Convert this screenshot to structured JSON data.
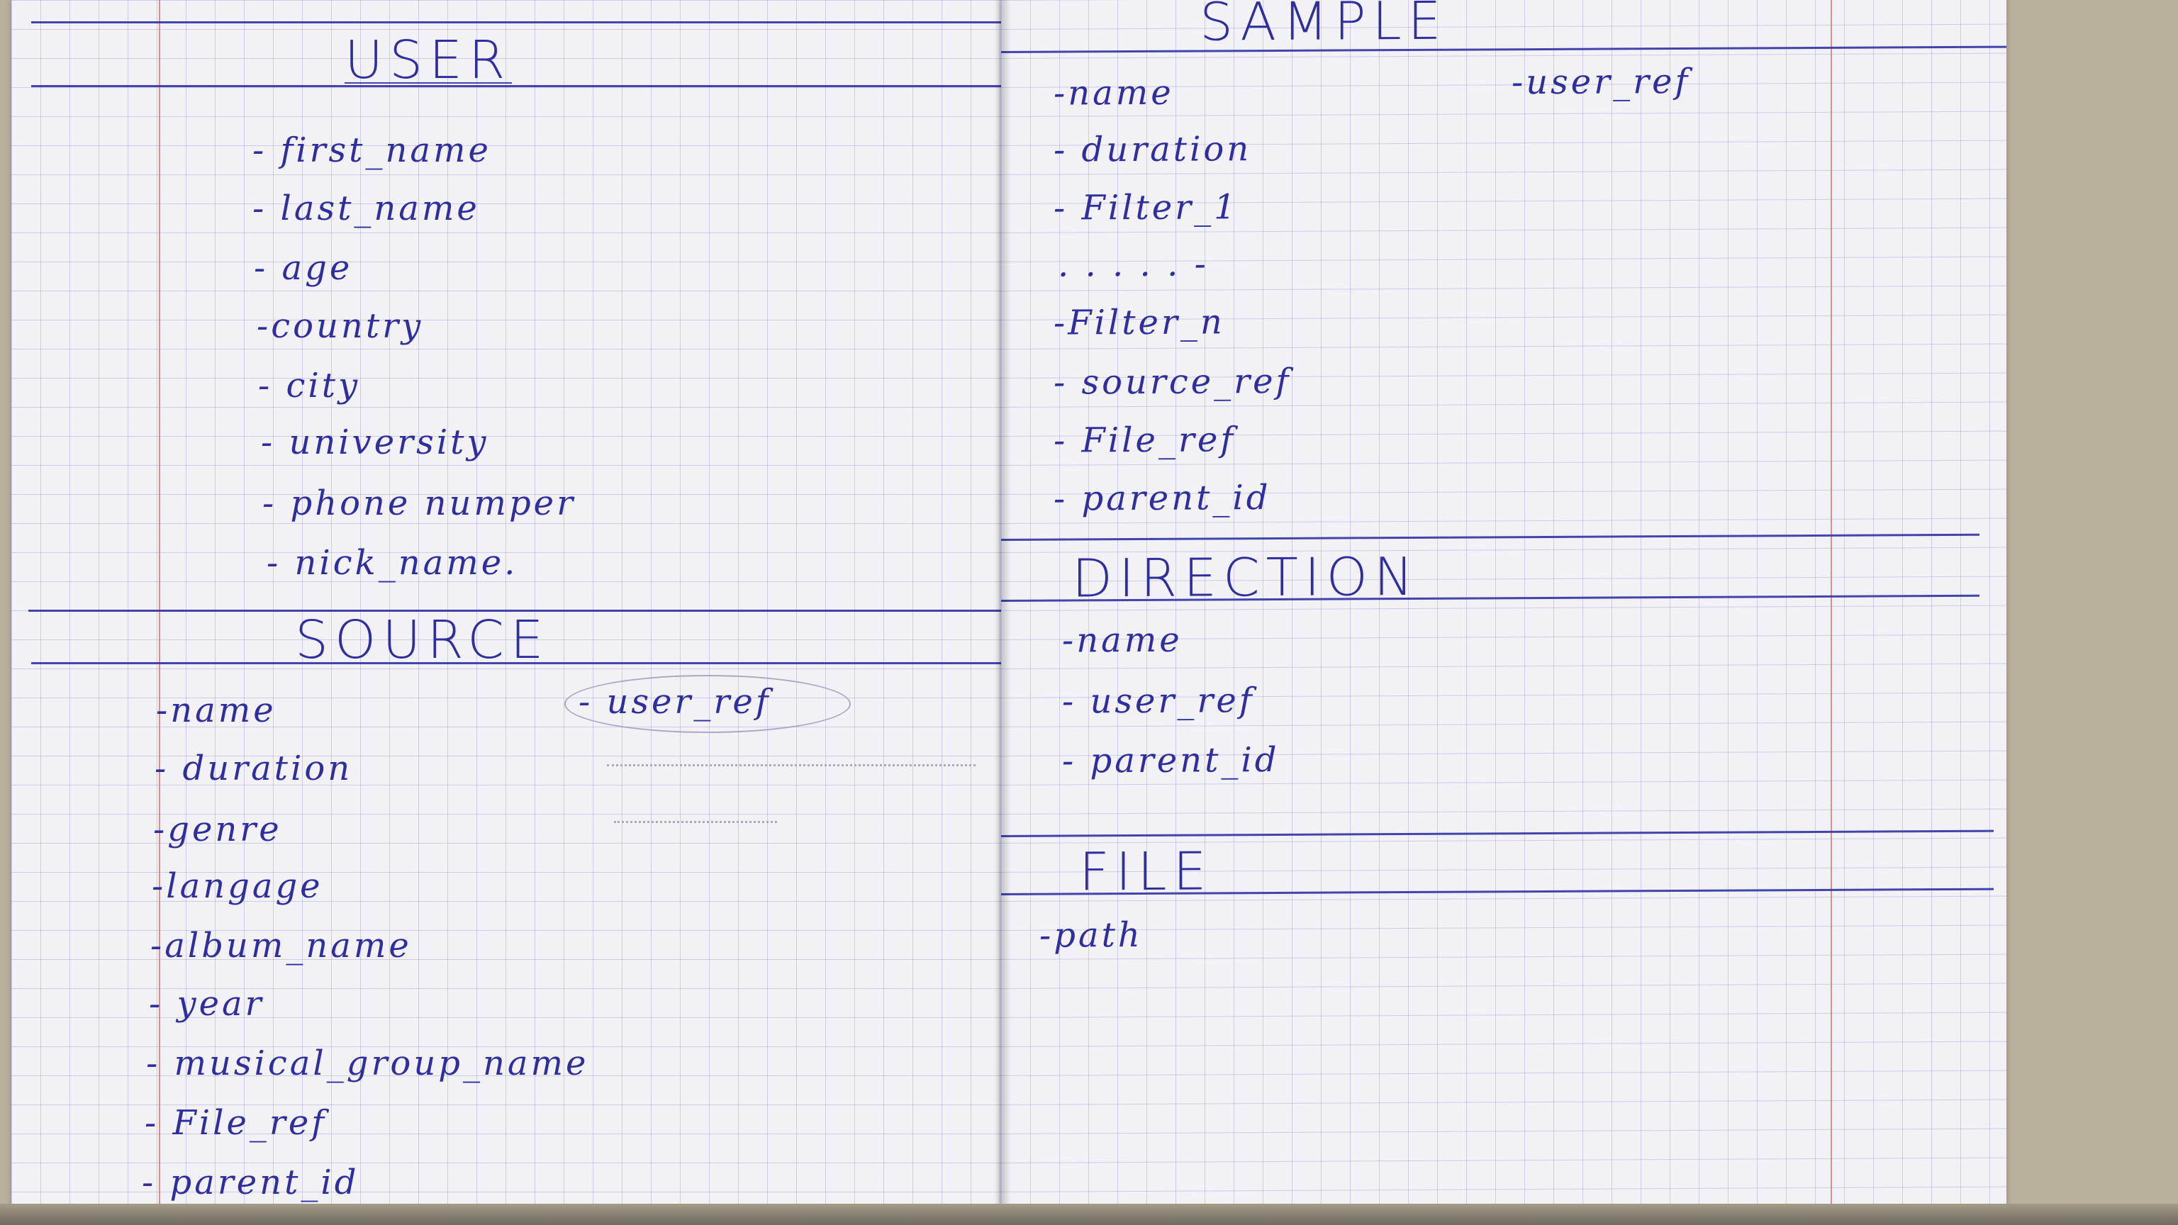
{
  "left_page": {
    "user": {
      "title": "USER",
      "fields": [
        "- first_name",
        "- last_name",
        "- age",
        "-country",
        "- city",
        "- university",
        "- phone numper",
        "- nick_name."
      ]
    },
    "source": {
      "title": "SOURCE",
      "fields": [
        "-name",
        "- duration",
        "-genre",
        "-langage",
        "-album_name",
        "- year",
        "- musical_group_name",
        "- File_ref",
        "- parent_id"
      ],
      "user_ref": "- user_ref"
    }
  },
  "right_page": {
    "sample": {
      "title": "SAMPLE",
      "fields": [
        "-name",
        "- duration",
        "- Filter_1",
        ". . . . . -",
        "-Filter_n",
        "- source_ref",
        "- File_ref",
        "- parent_id"
      ],
      "user_ref": "-user_ref"
    },
    "direction": {
      "title": "DIRECTION",
      "fields": [
        "-name",
        "- user_ref",
        "- parent_id"
      ]
    },
    "file": {
      "title": "FILE",
      "fields": [
        "-path"
      ]
    }
  },
  "colors": {
    "ink": "#2e2e9e",
    "grid": "#8e8ed0",
    "paper": "#f1f1f6",
    "margin": "#d97b7b"
  }
}
